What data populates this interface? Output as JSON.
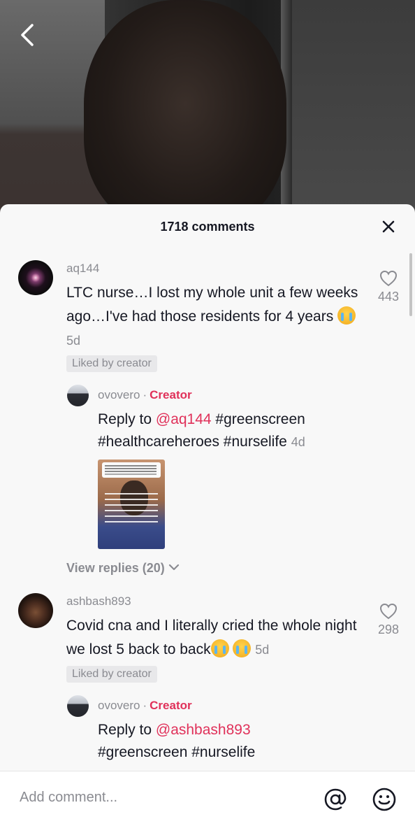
{
  "header": {
    "comments_title": "1718 comments"
  },
  "comments": [
    {
      "username": "aq144",
      "text": "LTC nurse…I lost my whole unit a few weeks ago…I've had those residents for 4 years",
      "time": "5d",
      "liked_by_creator": "Liked by creator",
      "like_count": "443",
      "reply": {
        "username": "ovovero",
        "separator": "·",
        "role": "Creator",
        "reply_prefix": "Reply to ",
        "mention": "@aq144",
        "text": " #greenscreen #healthcareheroes #nurselife",
        "time": "4d"
      },
      "view_replies": "View replies (20)"
    },
    {
      "username": "ashbash893",
      "text": "Covid cna and I literally cried the whole night we lost 5 back to back",
      "time": "5d",
      "liked_by_creator": "Liked by creator",
      "like_count": "298",
      "reply": {
        "username": "ovovero",
        "separator": "·",
        "role": "Creator",
        "reply_prefix": "Reply to ",
        "mention": "@ashbash893",
        "text": "#greenscreen #nurselife"
      }
    }
  ],
  "composer": {
    "placeholder": "Add comment..."
  },
  "icons": {
    "back": "chevron-left-icon",
    "close": "close-icon",
    "heart": "heart-outline-icon",
    "at": "at-sign-icon",
    "emoji": "smiley-icon",
    "chevron": "chevron-down-icon"
  },
  "colors": {
    "accent": "#e0315a",
    "muted": "#8a8b91",
    "text": "#161823",
    "sheet_bg": "#f8f8f8"
  }
}
